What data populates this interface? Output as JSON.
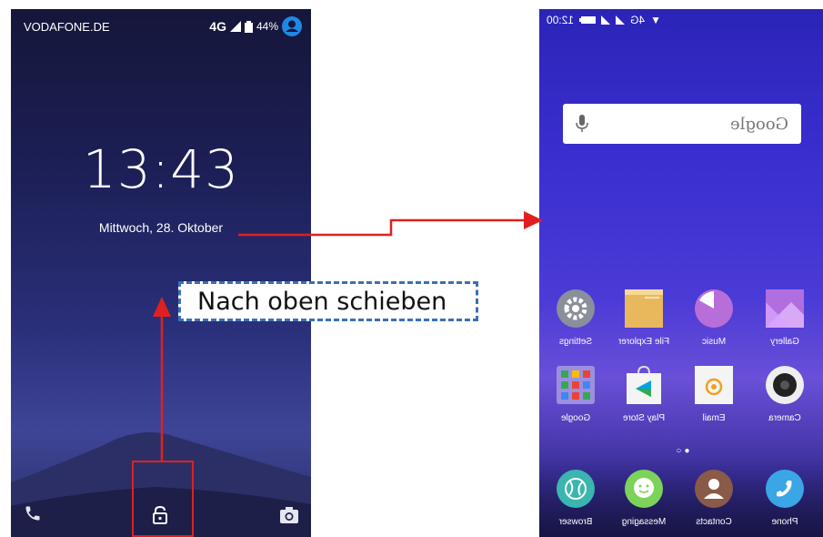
{
  "lockscreen": {
    "carrier": "VODAFONE.DE",
    "network": "4G",
    "battery": "44%",
    "time": "13:43",
    "date": "Mittwoch, 28. Oktober"
  },
  "annotation": {
    "label": "Nach oben schieben",
    "arrow_color": "#e02020",
    "box_border_color": "#3b6fb6"
  },
  "homescreen": {
    "status": {
      "time": "12:00",
      "network": "4G"
    },
    "search": {
      "placeholder": "Google"
    },
    "apps": [
      {
        "label": "Gallery",
        "icon": "gallery-icon"
      },
      {
        "label": "Music",
        "icon": "music-icon"
      },
      {
        "label": "File Explorer",
        "icon": "folder-icon"
      },
      {
        "label": "Settings",
        "icon": "gear-icon"
      },
      {
        "label": "Camera",
        "icon": "camera-icon"
      },
      {
        "label": "Email",
        "icon": "email-icon"
      },
      {
        "label": "Play Store",
        "icon": "play-store-icon"
      },
      {
        "label": "Google",
        "icon": "google-folder-icon"
      }
    ],
    "page_indicator": {
      "pages": 2,
      "current": 1
    },
    "dock": [
      {
        "label": "Phone",
        "icon": "phone-icon"
      },
      {
        "label": "Contacts",
        "icon": "contacts-icon"
      },
      {
        "label": "Messaging",
        "icon": "messaging-icon"
      },
      {
        "label": "Browser",
        "icon": "browser-icon"
      }
    ]
  },
  "colors": {
    "arrow_red": "#e02020",
    "dashed_blue": "#3b6fb6"
  }
}
